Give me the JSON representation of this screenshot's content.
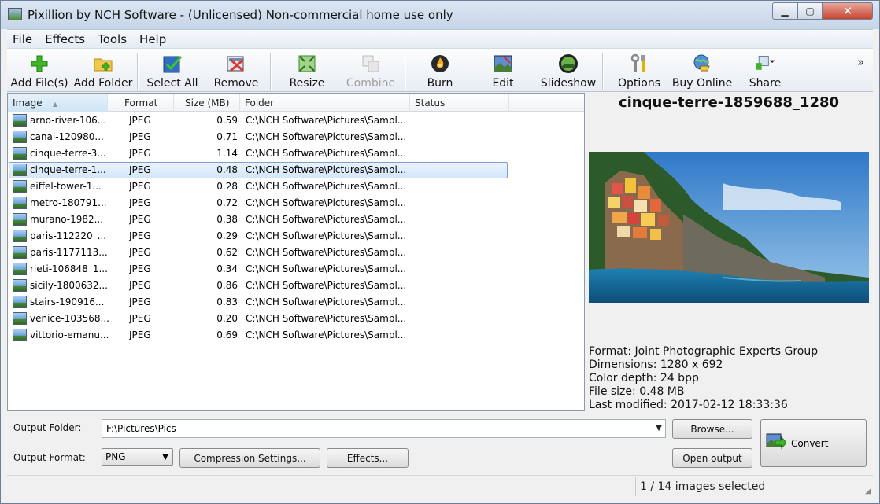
{
  "window": {
    "title": "Pixillion by NCH Software - (Unlicensed) Non-commercial home use only"
  },
  "menu": [
    "File",
    "Effects",
    "Tools",
    "Help"
  ],
  "toolbar": {
    "add_files": "Add File(s)",
    "add_folder": "Add Folder",
    "select_all": "Select All",
    "remove": "Remove",
    "resize": "Resize",
    "combine": "Combine",
    "burn": "Burn",
    "edit": "Edit",
    "slideshow": "Slideshow",
    "options": "Options",
    "buy_online": "Buy Online",
    "share": "Share",
    "more": "»"
  },
  "list": {
    "columns": {
      "image": "Image",
      "format": "Format",
      "size": "Size (MB)",
      "folder": "Folder",
      "status": "Status"
    },
    "rows": [
      {
        "name": "arno-river-106...",
        "format": "JPEG",
        "size": "0.59",
        "folder": "C:\\NCH Software\\Pictures\\Sampl...",
        "status": ""
      },
      {
        "name": "canal-120980...",
        "format": "JPEG",
        "size": "0.71",
        "folder": "C:\\NCH Software\\Pictures\\Sampl...",
        "status": ""
      },
      {
        "name": "cinque-terre-3...",
        "format": "JPEG",
        "size": "1.14",
        "folder": "C:\\NCH Software\\Pictures\\Sampl...",
        "status": ""
      },
      {
        "name": "cinque-terre-1...",
        "format": "JPEG",
        "size": "0.48",
        "folder": "C:\\NCH Software\\Pictures\\Sampl...",
        "status": "",
        "selected": true
      },
      {
        "name": "eiffel-tower-1...",
        "format": "JPEG",
        "size": "0.28",
        "folder": "C:\\NCH Software\\Pictures\\Sampl...",
        "status": ""
      },
      {
        "name": "metro-180791...",
        "format": "JPEG",
        "size": "0.72",
        "folder": "C:\\NCH Software\\Pictures\\Sampl...",
        "status": ""
      },
      {
        "name": "murano-1982...",
        "format": "JPEG",
        "size": "0.38",
        "folder": "C:\\NCH Software\\Pictures\\Sampl...",
        "status": ""
      },
      {
        "name": "paris-112220_...",
        "format": "JPEG",
        "size": "0.29",
        "folder": "C:\\NCH Software\\Pictures\\Sampl...",
        "status": ""
      },
      {
        "name": "paris-1177113...",
        "format": "JPEG",
        "size": "0.62",
        "folder": "C:\\NCH Software\\Pictures\\Sampl...",
        "status": ""
      },
      {
        "name": "rieti-106848_1...",
        "format": "JPEG",
        "size": "0.34",
        "folder": "C:\\NCH Software\\Pictures\\Sampl...",
        "status": ""
      },
      {
        "name": "sicily-1800632...",
        "format": "JPEG",
        "size": "0.86",
        "folder": "C:\\NCH Software\\Pictures\\Sampl...",
        "status": ""
      },
      {
        "name": "stairs-190916...",
        "format": "JPEG",
        "size": "0.83",
        "folder": "C:\\NCH Software\\Pictures\\Sampl...",
        "status": ""
      },
      {
        "name": "venice-103568...",
        "format": "JPEG",
        "size": "0.20",
        "folder": "C:\\NCH Software\\Pictures\\Sampl...",
        "status": ""
      },
      {
        "name": "vittorio-emanu...",
        "format": "JPEG",
        "size": "0.69",
        "folder": "C:\\NCH Software\\Pictures\\Sampl...",
        "status": ""
      }
    ]
  },
  "preview": {
    "title": "cinque-terre-1859688_1280",
    "format": "Format: Joint Photographic Experts Group",
    "dimensions": "Dimensions: 1280 x 692",
    "color_depth": "Color depth: 24 bpp",
    "file_size": "File size: 0.48 MB",
    "last_modified": "Last modified: 2017-02-12 18:33:36"
  },
  "output": {
    "folder_label": "Output Folder:",
    "folder_value": "F:\\Pictures\\Pics",
    "format_label": "Output Format:",
    "format_value": "PNG",
    "compression_button": "Compression Settings...",
    "effects_button": "Effects...",
    "browse_button": "Browse...",
    "open_output_button": "Open output",
    "convert_button": "Convert"
  },
  "status": {
    "text": "1 / 14 images selected"
  },
  "icons": {
    "add_files": "plus-icon",
    "add_folder": "folder-plus-icon",
    "select_all": "checkbox-icon",
    "remove": "remove-icon",
    "resize": "resize-icon",
    "combine": "combine-icon",
    "burn": "burn-disc-icon",
    "edit": "edit-image-icon",
    "slideshow": "slideshow-icon",
    "options": "tools-icon",
    "buy_online": "globe-cart-icon",
    "share": "share-icon",
    "convert": "convert-icon"
  }
}
